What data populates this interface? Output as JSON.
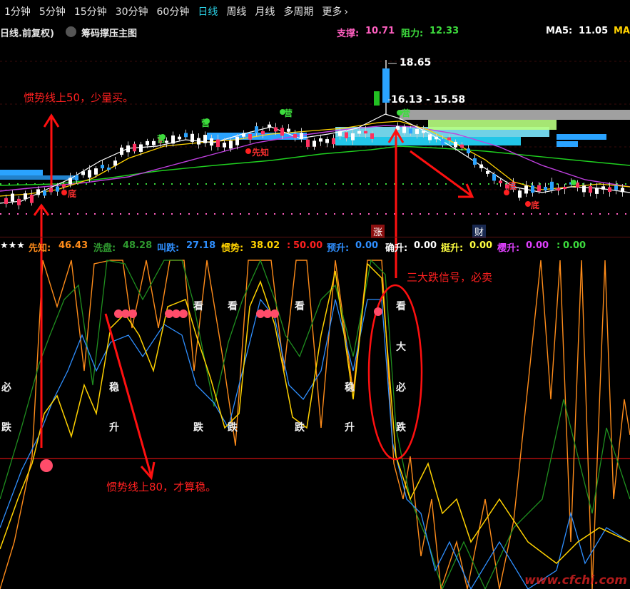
{
  "toolbar": {
    "periods": [
      "1分钟",
      "5分钟",
      "15分钟",
      "30分钟",
      "60分钟",
      "日线",
      "周线",
      "月线",
      "多周期",
      "更多"
    ],
    "active_index": 5,
    "more_chevron": "›"
  },
  "info": {
    "chart_label": "日线.前复权)",
    "dropdown_icon": "chevron-down",
    "main_indicator": "筹码撑压主图",
    "support_label": "支撑:",
    "support_value": "10.71",
    "resist_label": "阻力:",
    "resist_value": "12.33",
    "ma5_label": "MA5:",
    "ma5_value": "11.05",
    "ma_trunc": "MA",
    "colors": {
      "support": "#ff5fc0",
      "resist": "#3ddc3d",
      "ma5": "#ffffff",
      "ma": "#ffd200"
    }
  },
  "price_labels": {
    "high": "18.65",
    "band": "16.13 - 15.58"
  },
  "candle_tags": {
    "ying": "营",
    "xianzhi": "先知",
    "di": "底",
    "zhang": "涨",
    "cai": "财"
  },
  "indicator": {
    "stars": "★★★",
    "items": [
      {
        "label": "先知:",
        "value": "46.43",
        "color": "#ff8c1a"
      },
      {
        "label": "洗盘:",
        "value": "48.28",
        "color": "#2f9a2f"
      },
      {
        "label": "叫跌:",
        "value": "27.18",
        "color": "#2f8fff"
      },
      {
        "label": "惯势:",
        "value": "38.02",
        "color": "#ffd200"
      },
      {
        "label": ":",
        "value": "50.00",
        "color": "#ff2020"
      },
      {
        "label": "预升:",
        "value": "0.00",
        "color": "#2f8fff"
      },
      {
        "label": "确升:",
        "value": "0.00",
        "color": "#ffffff"
      },
      {
        "label": "挺升:",
        "value": "0.00",
        "color": "#ffff40"
      },
      {
        "label": "樱升:",
        "value": "0.00",
        "color": "#e040ff"
      },
      {
        "label": ":",
        "value": "0.00",
        "color": "#3ddc3d"
      }
    ]
  },
  "signals": {
    "kan": "看",
    "bi": "必",
    "die": "跌",
    "wen": "稳",
    "sheng": "升",
    "da": "大"
  },
  "annotations": {
    "top_left": "惯势线上50，少量买。",
    "right": "三大跌信号，必卖",
    "bottom": "惯势线上80，才算稳。"
  },
  "watermark": "www.cfchi.com"
}
